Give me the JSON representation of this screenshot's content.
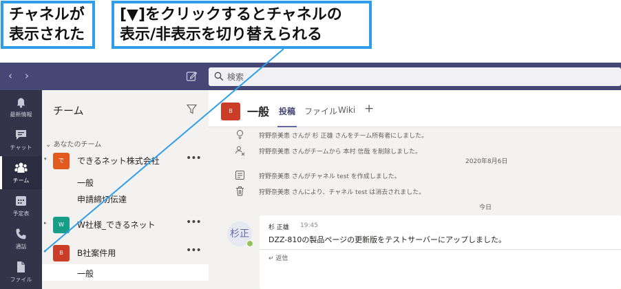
{
  "callouts": {
    "left": {
      "line1": "チャネルが",
      "line2": "表示された"
    },
    "right": {
      "line1": "[▼]をクリックするとチャネルの",
      "line2": "表示/非表示を切り替えられる"
    }
  },
  "title_bar": {
    "back_icon": "chevron-left-icon",
    "forward_icon": "chevron-right-icon",
    "compose_icon": "compose-icon",
    "search": {
      "icon": "search-icon",
      "placeholder": "検索"
    }
  },
  "app_rail": {
    "items": [
      {
        "label": "最新情報",
        "icon": "bell-icon",
        "active": false
      },
      {
        "label": "チャット",
        "icon": "chat-icon",
        "active": false
      },
      {
        "label": "チーム",
        "icon": "teams-icon",
        "active": true
      },
      {
        "label": "予定表",
        "icon": "calendar-icon",
        "active": false
      },
      {
        "label": "通話",
        "icon": "phone-icon",
        "active": false
      },
      {
        "label": "ファイル",
        "icon": "file-icon",
        "active": false
      }
    ]
  },
  "team_panel": {
    "title": "チーム",
    "section_label": "あなたのチーム",
    "teams": [
      {
        "name": "できるネット株式会社",
        "avatar": "で",
        "color": "#e35a21",
        "more": "•••",
        "channels": [
          {
            "name": "一般"
          },
          {
            "name": "申請締切伝達"
          }
        ]
      },
      {
        "name": "W社様_できるネット",
        "avatar": "W",
        "color": "#169e89",
        "more": "•••",
        "channels": []
      },
      {
        "name": "B社案件用",
        "avatar": "B",
        "color": "#cc3d27",
        "more": "•••",
        "channels": [
          {
            "name": "一般",
            "selected": true
          }
        ]
      }
    ]
  },
  "channel": {
    "avatar": "B",
    "title": "一般",
    "tabs": [
      {
        "label": "投稿",
        "active": true
      },
      {
        "label": "ファイル",
        "active": false
      },
      {
        "label": "Wiki",
        "active": false
      },
      {
        "label": "+",
        "active": false
      }
    ]
  },
  "feed": {
    "system_messages": [
      {
        "icon": "lightbulb-icon",
        "text": "狩野奈美恵 さんが 杉 正雄 さんをチーム所有者にしました。"
      },
      {
        "icon": "people-remove-icon",
        "text": "狩野奈美恵 さんがチームから 本村 信哉 を削除しました。"
      },
      {
        "icon": "channel-icon",
        "text": "狩野奈美恵 さんがチャネル test を作成しました。"
      },
      {
        "icon": "trash-icon",
        "text": "狩野奈美恵 さんにより、チャネル test は消去されました。"
      }
    ],
    "date_dividers": [
      "2020年8月6日",
      "今日"
    ],
    "message": {
      "avatar": "杉正",
      "author": "杉 正雄",
      "time": "19:45",
      "text": "DZZ-810の製品ページの更新版をテストサーバーにアップしました。",
      "reply_label": "返信",
      "reply_icon": "reply-icon"
    }
  }
}
